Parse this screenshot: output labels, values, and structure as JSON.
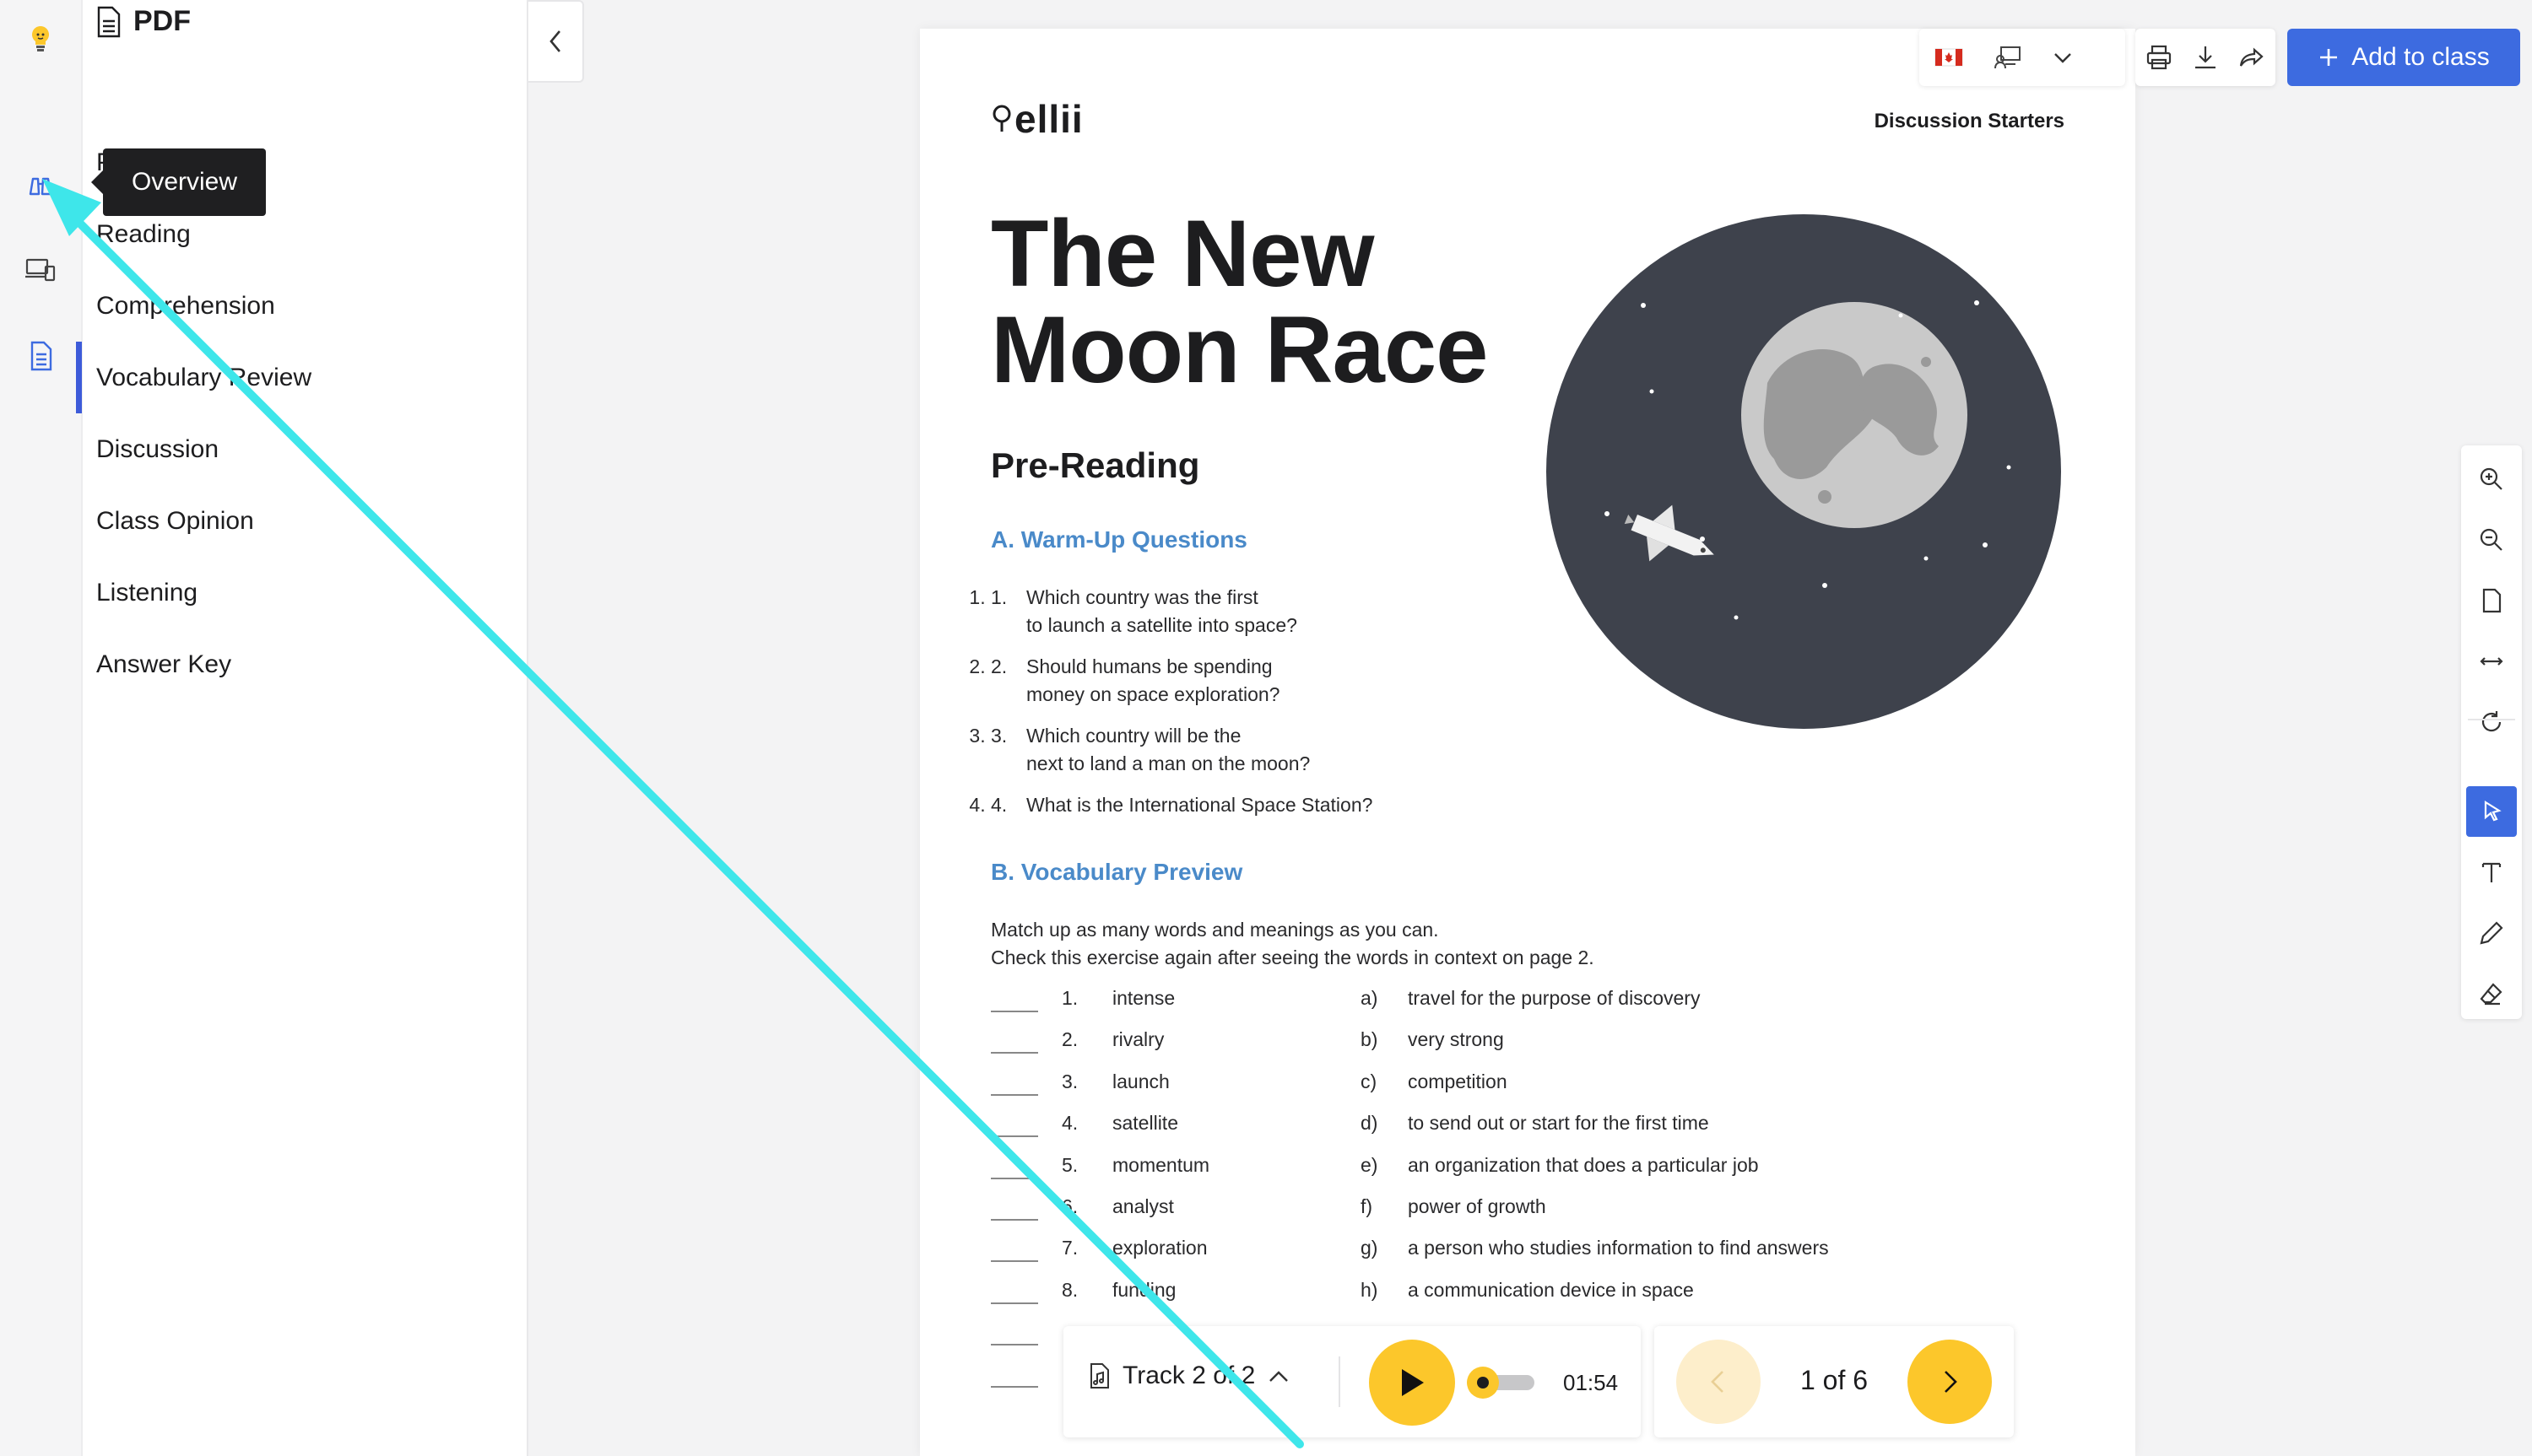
{
  "app": {
    "rail_items": [
      "lightbulb-icon",
      "binoculars-icon",
      "devices-icon",
      "document-icon"
    ],
    "accent_color": "#3d6be0",
    "highlight_color": "#fcc72b"
  },
  "tooltip": {
    "text": "Overview"
  },
  "sidebar": {
    "title": "PDF",
    "items": [
      {
        "label": "Pre-Reading"
      },
      {
        "label": "Reading"
      },
      {
        "label": "Comprehension"
      },
      {
        "label": "Vocabulary Review"
      },
      {
        "label": "Discussion"
      },
      {
        "label": "Class Opinion"
      },
      {
        "label": "Listening"
      },
      {
        "label": "Answer Key"
      }
    ],
    "active_item": "Vocabulary Review"
  },
  "toolbar": {
    "add_class_label": "Add to class",
    "icons": [
      "canada-flag-icon",
      "classroom-icon",
      "chevron-down-icon",
      "print-icon",
      "download-icon",
      "share-icon"
    ]
  },
  "tools": {
    "items": [
      "zoom-in-icon",
      "zoom-out-icon",
      "fit-page-icon",
      "fit-width-icon",
      "rotate-icon",
      "pointer-icon",
      "text-icon",
      "pencil-icon",
      "eraser-icon"
    ],
    "active": "pointer-icon"
  },
  "document": {
    "logo": "ellii",
    "category": "Discussion Starters",
    "title": "The New Moon Race",
    "section": "Pre-Reading",
    "part_a": {
      "title": "A. Warm-Up Questions",
      "questions": [
        {
          "num": "1.",
          "text": "Which country was the first\nto launch a satellite into space?"
        },
        {
          "num": "2.",
          "text": "Should humans be spending\nmoney on space exploration?"
        },
        {
          "num": "3.",
          "text": "Which country will be the\nnext to land a man on the moon?"
        },
        {
          "num": "4.",
          "text": "What is the International Space Station?"
        }
      ]
    },
    "part_b": {
      "title": "B. Vocabulary Preview",
      "instructions": "Match up as many words and meanings as you can.\nCheck this exercise again after seeing the words in context on page 2.",
      "rows": [
        {
          "num": "1.",
          "word": "intense",
          "letter": "a)",
          "meaning": "travel for the purpose of discovery"
        },
        {
          "num": "2.",
          "word": "rivalry",
          "letter": "b)",
          "meaning": "very strong"
        },
        {
          "num": "3.",
          "word": "launch",
          "letter": "c)",
          "meaning": "competition"
        },
        {
          "num": "4.",
          "word": "satellite",
          "letter": "d)",
          "meaning": "to send out or start for the first time"
        },
        {
          "num": "5.",
          "word": "momentum",
          "letter": "e)",
          "meaning": "an organization that does a particular job"
        },
        {
          "num": "6.",
          "word": "analyst",
          "letter": "f)",
          "meaning": "power of growth"
        },
        {
          "num": "7.",
          "word": "exploration",
          "letter": "g)",
          "meaning": "a person who studies information to find answers"
        },
        {
          "num": "8.",
          "word": "funding",
          "letter": "h)",
          "meaning": "a communication device in space"
        },
        {
          "num": "",
          "word": "",
          "letter": "",
          "meaning": ""
        },
        {
          "num": "",
          "word": "",
          "letter": "",
          "meaning": ""
        }
      ]
    }
  },
  "player": {
    "track_label": "Track 2 of 2",
    "time": "01:54",
    "progress_fraction": 0.05
  },
  "pager": {
    "label": "1 of 6"
  }
}
